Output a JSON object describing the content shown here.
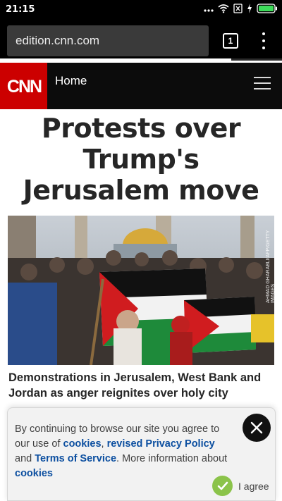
{
  "status_bar": {
    "time": "21:15",
    "icons": [
      "more-dots-icon",
      "wifi-icon",
      "sim-off-icon",
      "charging-icon",
      "battery-icon"
    ],
    "battery_color": "#3ddc5a"
  },
  "browser": {
    "url": "edition.cnn.com",
    "tab_count": "1",
    "load_progress": 0.82
  },
  "site_header": {
    "logo_text": "CNN",
    "nav_label": "Home",
    "brand_color": "#cc0000"
  },
  "article": {
    "headline": "Protests over Trump's Jerusalem move",
    "image_credit": "AHMAD GHARABLI/AFP/GETTY IMAGES",
    "story_title": "Demonstrations in Jerusalem, West Bank and Jordan as anger reignites over holy city"
  },
  "cookie_notice": {
    "text_before": "By continuing to browse our site you agree to our use of ",
    "link_cookies": "cookies",
    "sep1": ", ",
    "link_privacy": "revised Privacy Policy",
    "and": " and ",
    "link_terms": "Terms of Service",
    "more": ". More information about ",
    "link_cookies_info": "cookies",
    "agree_label": "I agree",
    "link_color": "#0c4fa0",
    "agree_color": "#8bc34a"
  }
}
